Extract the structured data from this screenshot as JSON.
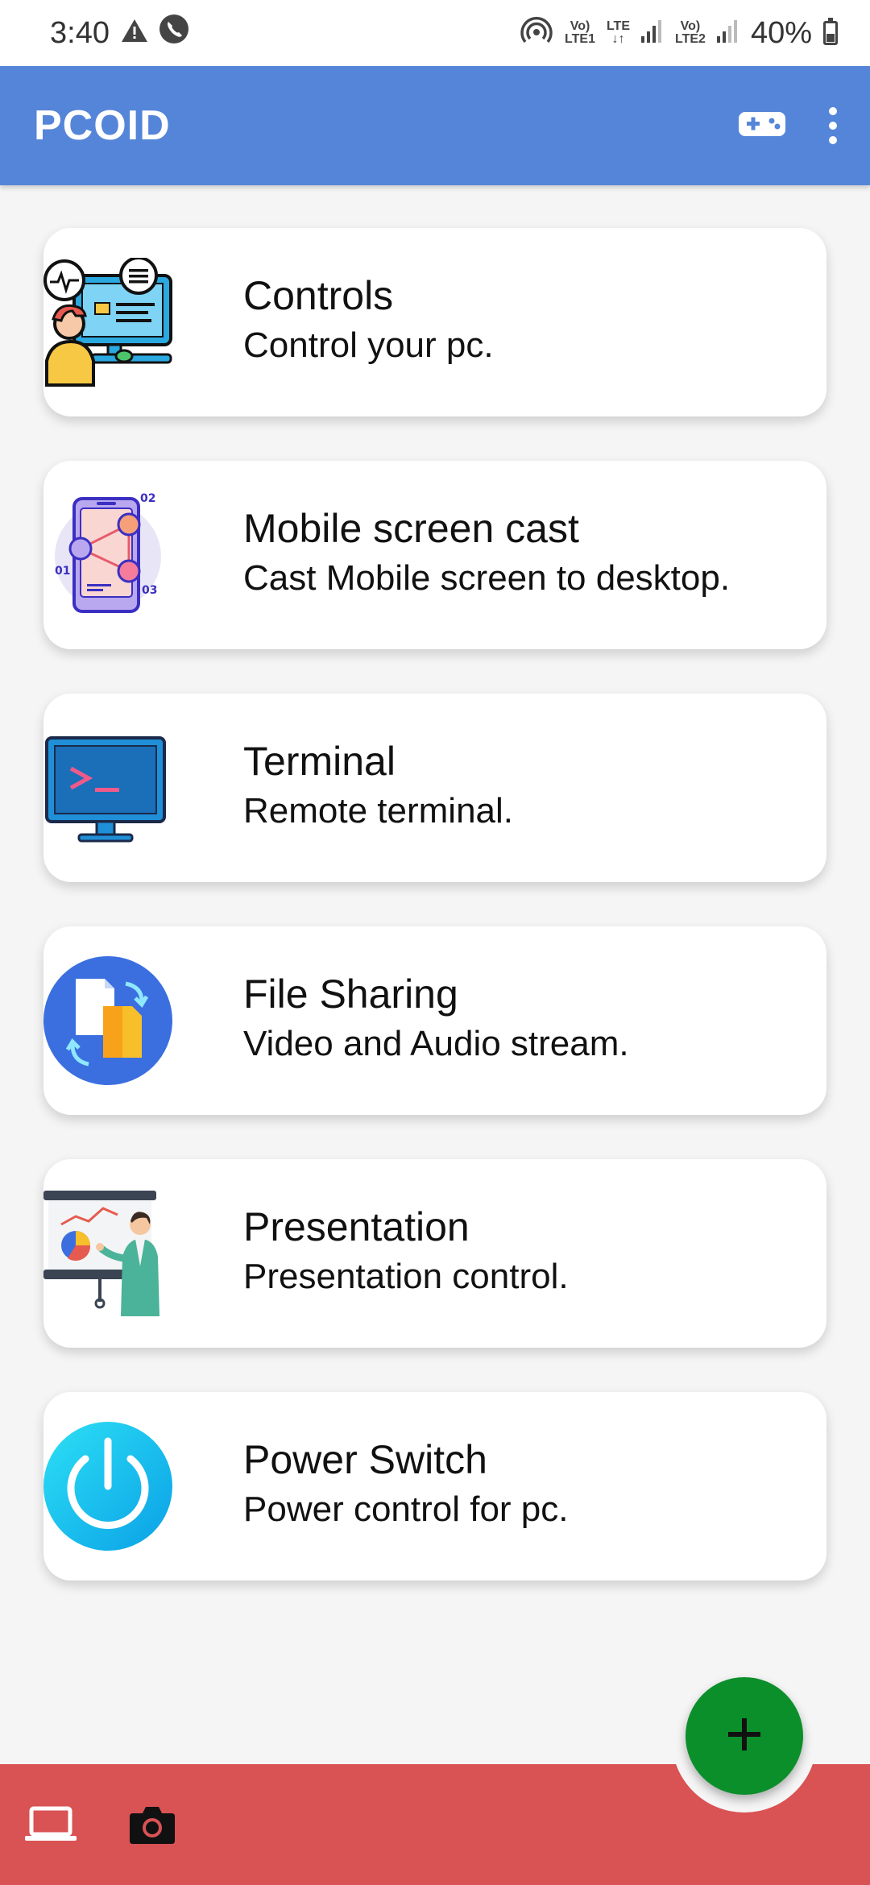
{
  "status_bar": {
    "time": "3:40",
    "volte1": "Vo)",
    "lte1": "LTE1",
    "lte": "LTE",
    "volte2": "Vo)",
    "lte2": "LTE2",
    "battery": "40%"
  },
  "app_bar": {
    "title": "PCOID",
    "icons": [
      "gamepad-icon",
      "more-vert-icon"
    ]
  },
  "cards": [
    {
      "title": "Controls",
      "subtitle": "Control your pc.",
      "icon": "controls-illustration-icon"
    },
    {
      "title": "Mobile screen cast",
      "subtitle": "Cast Mobile screen to desktop.",
      "icon": "mobile-cast-illustration-icon"
    },
    {
      "title": "Terminal",
      "subtitle": "Remote terminal.",
      "icon": "terminal-monitor-icon"
    },
    {
      "title": "File Sharing",
      "subtitle": "Video and Audio stream.",
      "icon": "file-sharing-icon"
    },
    {
      "title": "Presentation",
      "subtitle": "Presentation control.",
      "icon": "presentation-icon"
    },
    {
      "title": "Power Switch",
      "subtitle": "Power control for pc.",
      "icon": "power-switch-icon"
    }
  ],
  "fab": {
    "icon": "plus-icon"
  },
  "bottom_bar": {
    "icons": [
      "laptop-icon",
      "camera-icon"
    ]
  },
  "colors": {
    "app_bar": "#5585d9",
    "bottom_bar": "#d95254",
    "fab": "#0b8f2a",
    "background": "#f5f5f5"
  }
}
